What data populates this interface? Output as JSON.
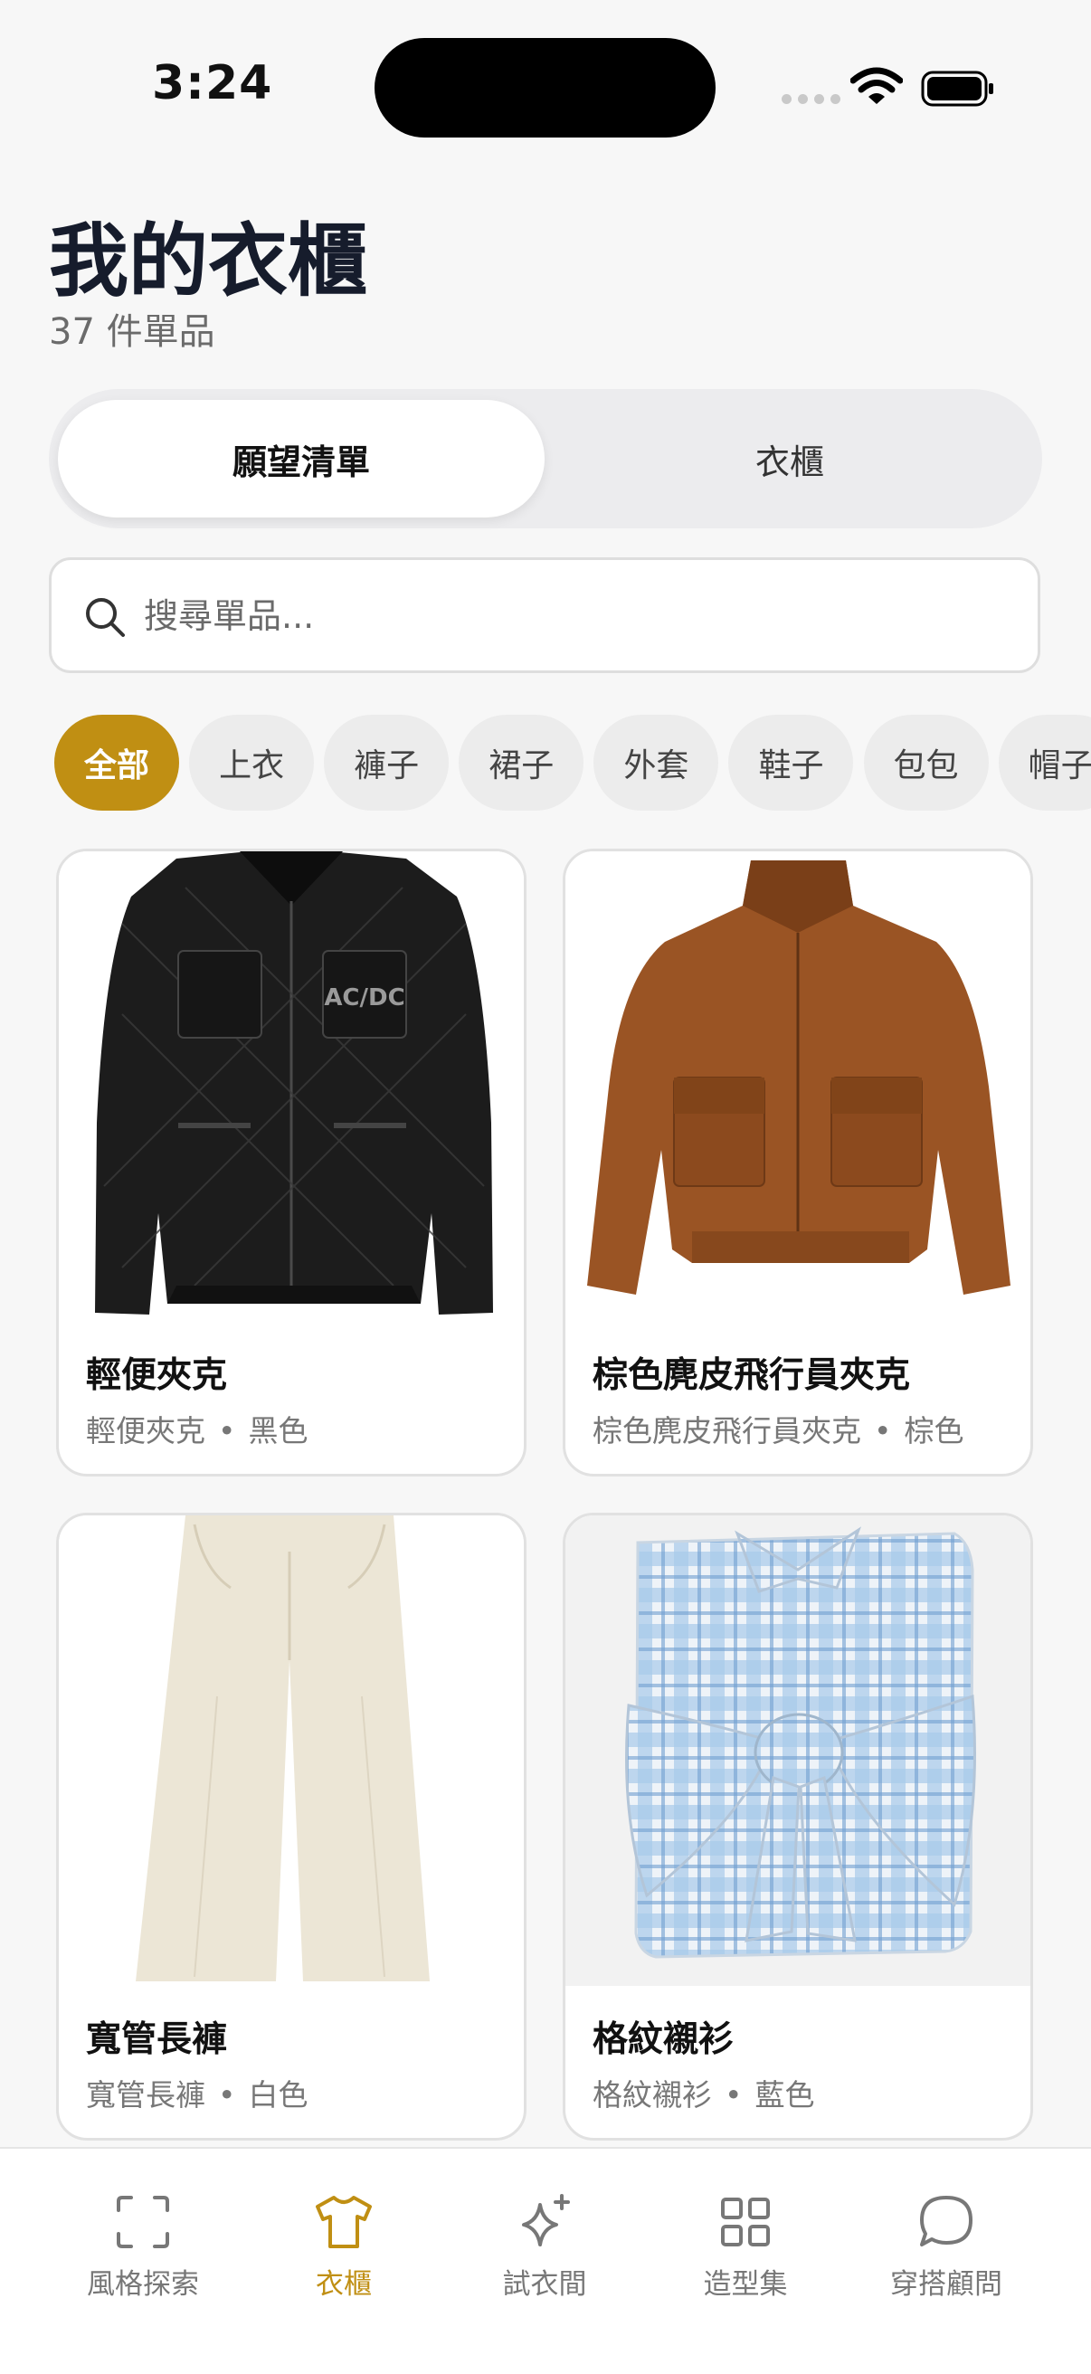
{
  "status_bar": {
    "time": "3:24"
  },
  "header": {
    "title": "我的衣櫃",
    "count": "37 件單品"
  },
  "segments": {
    "active": "願望清單",
    "inactive": "衣櫃"
  },
  "search": {
    "placeholder": "搜尋單品..."
  },
  "chips": [
    "全部",
    "上衣",
    "褲子",
    "裙子",
    "外套",
    "鞋子",
    "包包",
    "帽子"
  ],
  "cards": [
    {
      "title": "輕便夾克",
      "sub_name": "輕便夾克",
      "sub_color": "黑色",
      "separator": "•"
    },
    {
      "title": "棕色麂皮飛行員夾克",
      "sub_name": "棕色麂皮飛行員夾克",
      "sub_color": "棕色",
      "separator": "•"
    },
    {
      "title": "寬管長褲",
      "sub_name": "寬管長褲",
      "sub_color": "白色",
      "separator": "•"
    },
    {
      "title": "格紋襯衫",
      "sub_name": "格紋襯衫",
      "sub_color": "藍色",
      "separator": "•"
    }
  ],
  "jacket_patch": "AC/DC",
  "tabs": [
    {
      "label": "風格探索",
      "icon": "scan-icon"
    },
    {
      "label": "衣櫃",
      "icon": "tshirt-icon"
    },
    {
      "label": "試衣間",
      "icon": "sparkle-icon"
    },
    {
      "label": "造型集",
      "icon": "grid-icon"
    },
    {
      "label": "穿搭顧問",
      "icon": "chat-icon"
    }
  ],
  "colors": {
    "accent": "#c08f13",
    "background": "#f7f7f7"
  }
}
